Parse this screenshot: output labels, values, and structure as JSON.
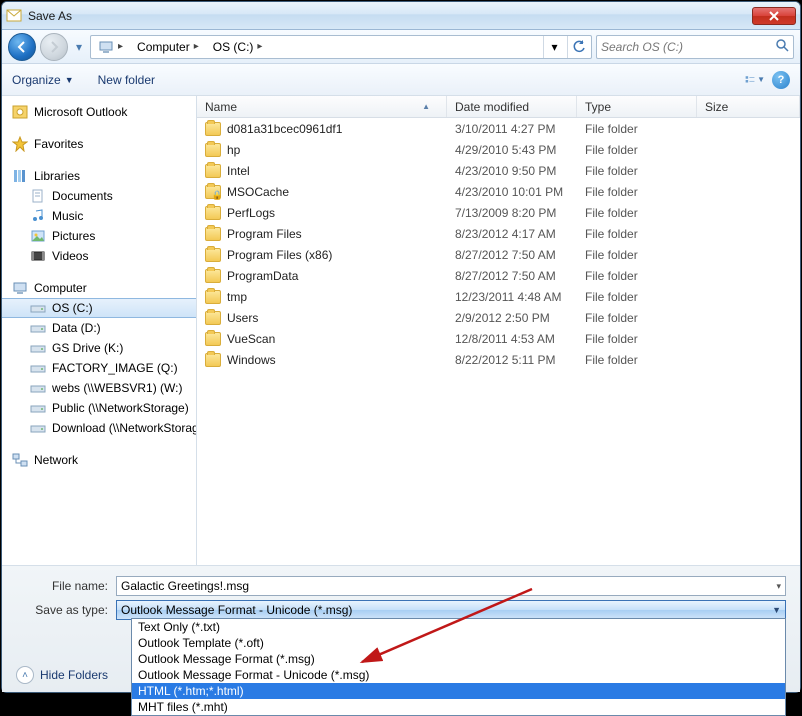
{
  "window": {
    "title": "Save As"
  },
  "nav": {
    "breadcrumb": [
      "Computer",
      "OS (C:)"
    ],
    "search_placeholder": "Search OS (C:)"
  },
  "cmdbar": {
    "organize": "Organize",
    "newfolder": "New folder"
  },
  "navpane": {
    "outlook": "Microsoft Outlook",
    "favorites": "Favorites",
    "libraries": "Libraries",
    "lib_items": [
      "Documents",
      "Music",
      "Pictures",
      "Videos"
    ],
    "computer": "Computer",
    "drives": [
      {
        "label": "OS (C:)",
        "selected": true
      },
      {
        "label": "Data (D:)"
      },
      {
        "label": "GS Drive (K:)"
      },
      {
        "label": "FACTORY_IMAGE (Q:)"
      },
      {
        "label": "webs (\\\\WEBSVR1) (W:)"
      },
      {
        "label": "Public (\\\\NetworkStorage)"
      },
      {
        "label": "Download (\\\\NetworkStorage)"
      }
    ],
    "network": "Network"
  },
  "columns": {
    "name": "Name",
    "date": "Date modified",
    "type": "Type",
    "size": "Size"
  },
  "rows": [
    {
      "name": "d081a31bcec0961df1",
      "date": "3/10/2011 4:27 PM",
      "type": "File folder",
      "locked": false
    },
    {
      "name": "hp",
      "date": "4/29/2010 5:43 PM",
      "type": "File folder",
      "locked": false
    },
    {
      "name": "Intel",
      "date": "4/23/2010 9:50 PM",
      "type": "File folder",
      "locked": false
    },
    {
      "name": "MSOCache",
      "date": "4/23/2010 10:01 PM",
      "type": "File folder",
      "locked": true
    },
    {
      "name": "PerfLogs",
      "date": "7/13/2009 8:20 PM",
      "type": "File folder",
      "locked": false
    },
    {
      "name": "Program Files",
      "date": "8/23/2012 4:17 AM",
      "type": "File folder",
      "locked": false
    },
    {
      "name": "Program Files (x86)",
      "date": "8/27/2012 7:50 AM",
      "type": "File folder",
      "locked": false
    },
    {
      "name": "ProgramData",
      "date": "8/27/2012 7:50 AM",
      "type": "File folder",
      "locked": false
    },
    {
      "name": "tmp",
      "date": "12/23/2011 4:48 AM",
      "type": "File folder",
      "locked": false
    },
    {
      "name": "Users",
      "date": "2/9/2012 2:50 PM",
      "type": "File folder",
      "locked": false
    },
    {
      "name": "VueScan",
      "date": "12/8/2011 4:53 AM",
      "type": "File folder",
      "locked": false
    },
    {
      "name": "Windows",
      "date": "8/22/2012 5:11 PM",
      "type": "File folder",
      "locked": false
    }
  ],
  "bottom": {
    "filename_label": "File name:",
    "filename_value": "Galactic Greetings!.msg",
    "type_label": "Save as type:",
    "type_value": "Outlook Message Format - Unicode (*.msg)",
    "type_options": [
      "Text Only (*.txt)",
      "Outlook Template (*.oft)",
      "Outlook Message Format (*.msg)",
      "Outlook Message Format - Unicode (*.msg)",
      "HTML (*.htm;*.html)",
      "MHT files (*.mht)"
    ],
    "type_selected_index": 4,
    "hide_folders": "Hide Folders"
  }
}
